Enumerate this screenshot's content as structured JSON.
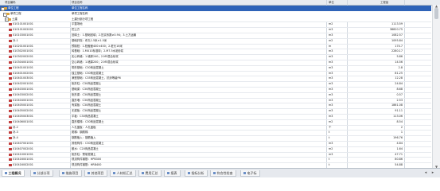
{
  "header": {
    "col_code": "项目编码",
    "col_name": "项目名称",
    "col_unit": "单位",
    "col_qty": "工程量"
  },
  "rows": [
    {
      "kind": "sel",
      "code": "单位工程",
      "name": "单位工程名称",
      "unit": "",
      "qty": ""
    },
    {
      "kind": "group",
      "code": "单项工程",
      "name": "单项工程名称",
      "unit": "",
      "qty": ""
    },
    {
      "kind": "group",
      "code": "土建",
      "name": "土建分部分项工程",
      "unit": "",
      "qty": ""
    },
    {
      "kind": "item",
      "code": "010101001001",
      "name": "平整场地",
      "unit": "m2",
      "qty": "1113.59"
    },
    {
      "kind": "item",
      "code": "010101002001",
      "name": "挖土方",
      "unit": "m3",
      "qty": "38820.75"
    },
    {
      "kind": "item",
      "code": "010103001001",
      "name": "回填土：1.基础回填；2.压实系数≥0.94；3.土方运输",
      "unit": "m3",
      "qty": "1082.57"
    },
    {
      "kind": "item",
      "code": "补-1",
      "name": "基础钎探：布孔1.5米×1.5米",
      "unit": "m2",
      "qty": "1095.84"
    },
    {
      "kind": "item",
      "code": "010201001001",
      "name": "预制桩：1.桩截面400×400；2.桩长18米",
      "unit": "m",
      "qty": "174.7"
    },
    {
      "kind": "item",
      "code": "010302001001",
      "name": "砖基础：1.MU10标准砖；2.M7.5水泥砂浆",
      "unit": "m3",
      "qty": "2280.17"
    },
    {
      "kind": "item",
      "code": "010302002001",
      "name": "实心砖墙：1.墙厚240；2.M5混合砂浆",
      "unit": "m3",
      "qty": "5.86"
    },
    {
      "kind": "item",
      "code": "010304001001",
      "name": "空心砖墙：1.墙厚200；2.M5混合砂浆",
      "unit": "m3",
      "qty": "14.56"
    },
    {
      "kind": "item",
      "code": "010401001001",
      "name": "带形基础：C30商品混凝土",
      "unit": "m3",
      "qty": "2.8"
    },
    {
      "kind": "item",
      "code": "010401002001",
      "name": "独立基础：C30商品混凝土",
      "unit": "m3",
      "qty": "81.25"
    },
    {
      "kind": "item",
      "code": "010401003001",
      "name": "满堂基础：C35商品混凝土，抗渗等级P6",
      "unit": "m3",
      "qty": "12.28"
    },
    {
      "kind": "item",
      "code": "010402001001",
      "name": "矩形柱：C30商品混凝土",
      "unit": "m3",
      "qty": "24.84"
    },
    {
      "kind": "item",
      "code": "010403001001",
      "name": "基础梁：C30商品混凝土",
      "unit": "m3",
      "qty": "8.68"
    },
    {
      "kind": "item",
      "code": "010403002001",
      "name": "矩形梁：C30商品混凝土",
      "unit": "m3",
      "qty": "0.57"
    },
    {
      "kind": "item",
      "code": "010404001001",
      "name": "直形墙：C30商品混凝土",
      "unit": "m3",
      "qty": "2.53"
    },
    {
      "kind": "item",
      "code": "010405001001",
      "name": "有梁板：C30商品混凝土",
      "unit": "m3",
      "qty": "1861.08"
    },
    {
      "kind": "item",
      "code": "010405002001",
      "name": "无梁板：C30商品混凝土",
      "unit": "m3",
      "qty": "91.11"
    },
    {
      "kind": "item",
      "code": "010405003001",
      "name": "平板：C30商品混凝土",
      "unit": "m3",
      "qty": "113.06"
    },
    {
      "kind": "item",
      "code": "010406001001",
      "name": "直形楼梯：C30商品混凝土",
      "unit": "m2",
      "qty": "8.54"
    },
    {
      "kind": "item",
      "code": "补-2",
      "name": "人孔盖板：人孔盖板",
      "unit": "个",
      "qty": "2"
    },
    {
      "kind": "item",
      "code": "补-3",
      "name": "爬梯：钢爬梯",
      "unit": "t",
      "qty": "1"
    },
    {
      "kind": "item",
      "code": "补-4",
      "name": "钢筋植入：钢筋植入",
      "unit": "t",
      "qty": "196.76"
    },
    {
      "kind": "item",
      "code": "010407001001",
      "name": "其他构件：C30商品混凝土",
      "unit": "m3",
      "qty": "4.84"
    },
    {
      "kind": "item",
      "code": "010407002001",
      "name": "散水：C20商品混凝土",
      "unit": "m2",
      "qty": "1.64"
    },
    {
      "kind": "item",
      "code": "010410001001",
      "name": "矩形柱：预制混凝土",
      "unit": "m3",
      "qty": "47.71"
    },
    {
      "kind": "item",
      "code": "010416001001",
      "name": "现浇构件钢筋：HPB300",
      "unit": "t",
      "qty": "80.86"
    },
    {
      "kind": "item",
      "code": "010416002001",
      "name": "现浇构件钢筋：HRB400",
      "unit": "t",
      "qty": "54.88"
    }
  ],
  "tabs": [
    {
      "label": "工程概况"
    },
    {
      "label": "分部分项"
    },
    {
      "label": "措施项目"
    },
    {
      "label": "其他项目"
    },
    {
      "label": "人材机汇总"
    },
    {
      "label": "费用汇总"
    },
    {
      "label": "报表"
    },
    {
      "label": "指标分析"
    },
    {
      "label": "符合性检查"
    },
    {
      "label": "电子标"
    }
  ]
}
